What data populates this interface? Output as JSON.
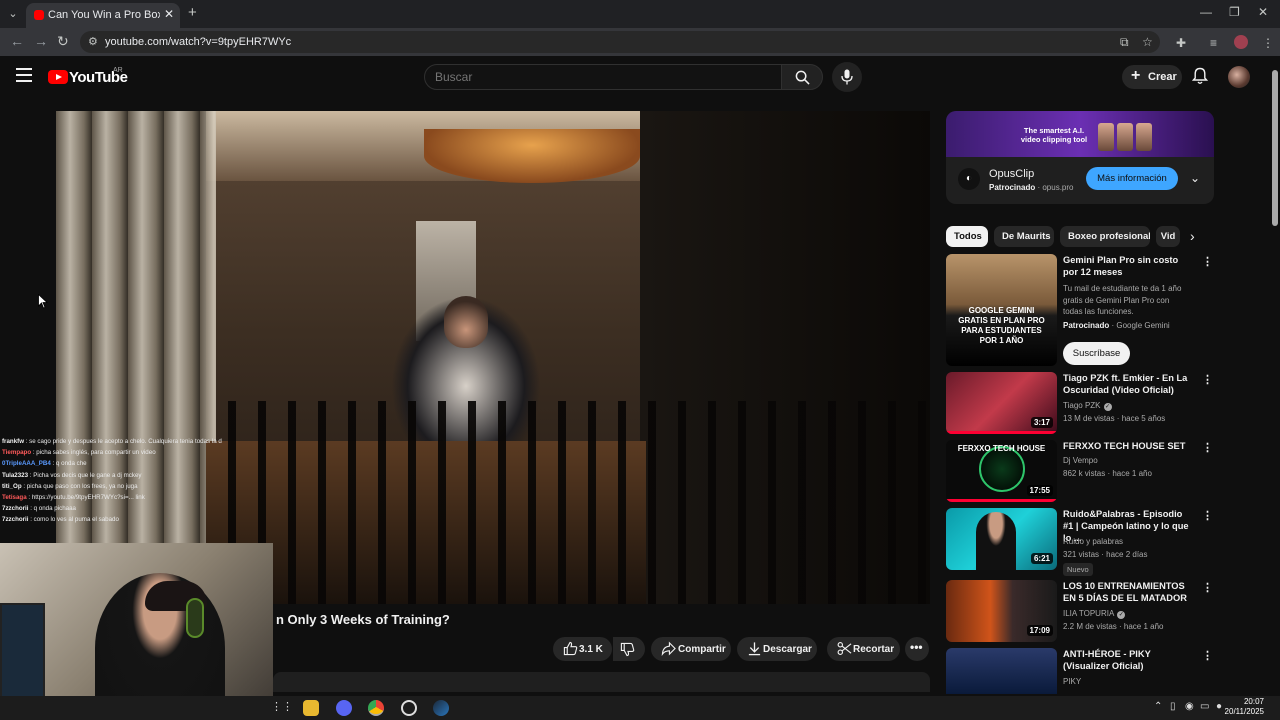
{
  "browser": {
    "tab_title": "Can You Win a Pro Boxing Fight",
    "url": "youtube.com/watch?v=9tpyEHR7WYc"
  },
  "header": {
    "logo_text": "YouTube",
    "country_code": "AR",
    "search_placeholder": "Buscar",
    "create_label": "Crear"
  },
  "chat": [
    {
      "user": "frankfw",
      "text": " : se cago pride y despues le acepto a chelo. Cualquiera tenia todas la de ganar jaja"
    },
    {
      "user": "Tiempapo",
      "text": " : picha sabes inglés, para compartir un video"
    },
    {
      "user": "0TripleAAA_PB4",
      "text": " : q onda che"
    },
    {
      "user": "Tula2323",
      "text": " : Picha vos decis que le gane a dj mckey"
    },
    {
      "user": "titi_Op",
      "text": " : picha que paso con los frees, ya no juga"
    },
    {
      "user": "Tetisaga",
      "text": " : https://youtu.be/9tpyEHR7WYc?si=... link"
    },
    {
      "user": "7zzchorii",
      "text": " : q onda pichaaa"
    },
    {
      "user": "7zzchorii",
      "text": " : como lo ves al puma el sabado"
    }
  ],
  "video": {
    "title_visible": "n Only 3 Weeks of Training?",
    "likes": "3.1 K",
    "share_label": "Compartir",
    "download_label": "Descargar",
    "clip_label": "Recortar"
  },
  "ad": {
    "banner_text": "The smartest A.I. video clipping tool",
    "name": "OpusClip",
    "sponsored_label": "Patrocinado",
    "domain": "opus.pro",
    "cta": "Más información"
  },
  "chips": [
    "Todos",
    "De Maurits",
    "Boxeo profesional",
    "Vid"
  ],
  "recommendations": [
    {
      "title": "Gemini Plan Pro sin costo por 12 meses",
      "description": "Tu mail de estudiante te da 1 año gratis de Gemini Plan Pro con todas las funciones.",
      "sponsored": "Patrocinado",
      "channel": "Google Gemini",
      "thumb_text": "GOOGLE GEMINI\nGRATIS EN PLAN PRO PARA ESTUDIANTES POR 1 AÑO",
      "cta": "Suscríbase"
    },
    {
      "title": "Tiago PZK ft. Emkier - En La Oscuridad (Video Oficial)",
      "channel": "Tiago PZK",
      "meta": "13 M de vistas · hace 5 años",
      "duration": "3:17"
    },
    {
      "title": "FERXXO TECH HOUSE SET",
      "channel": "Dj Vempo",
      "meta": "862 k vistas · hace 1 año",
      "duration": "17:55",
      "thumb_text": "FERXXO TECH HOUSE"
    },
    {
      "title": "Ruido&Palabras - Episodio #1 | Campeón latino y lo que lo ...",
      "channel": "Ruido y palabras",
      "meta": "321 vistas · hace 2 días",
      "badge": "Nuevo",
      "duration": "6:21"
    },
    {
      "title": "LOS 10 ENTRENAMIENTOS EN 5 DÍAS DE EL MATADOR",
      "channel": "ILIA TOPURIA",
      "meta": "2.2 M de vistas · hace 1 año",
      "duration": "17:09"
    },
    {
      "title": "ANTI-HÉROE - PIKY  (Visualizer Oficial)",
      "channel": "PIKY"
    }
  ],
  "taskbar": {
    "time": "20:07",
    "date": "20/11/2025"
  },
  "icons": [
    "menu-icon",
    "search-icon",
    "mic-icon",
    "bell-icon",
    "like-icon",
    "dislike-icon",
    "share-icon",
    "download-icon",
    "scissors-icon",
    "more-icon"
  ],
  "colors": {
    "accent": "#ff0000",
    "cta_blue": "#3ea6ff",
    "background": "#0f0f0f"
  }
}
